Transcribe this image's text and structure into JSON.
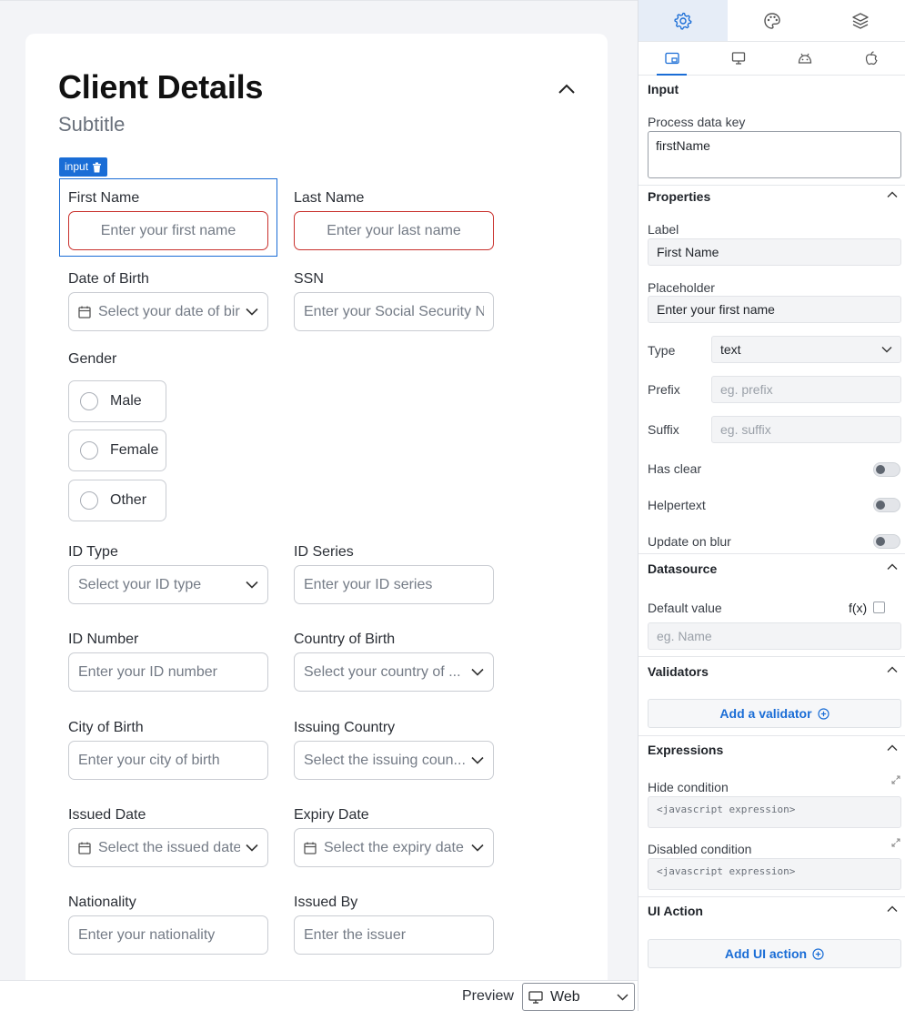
{
  "form": {
    "title": "Client Details",
    "subtitle": "Subtitle",
    "selected_tag": "input",
    "fields": {
      "first_name": {
        "label": "First Name",
        "placeholder": "Enter your first name"
      },
      "last_name": {
        "label": "Last Name",
        "placeholder": "Enter your last name"
      },
      "dob": {
        "label": "Date of Birth",
        "placeholder": "Select your date of birth"
      },
      "ssn": {
        "label": "SSN",
        "placeholder": "Enter your Social Security Number"
      },
      "id_type": {
        "label": "ID Type",
        "placeholder": "Select your ID type"
      },
      "id_series": {
        "label": "ID Series",
        "placeholder": "Enter your ID series"
      },
      "id_number": {
        "label": "ID Number",
        "placeholder": "Enter your ID number"
      },
      "country_of_birth": {
        "label": "Country of Birth",
        "placeholder": "Select your country of ..."
      },
      "city_of_birth": {
        "label": "City of Birth",
        "placeholder": "Enter your city of birth"
      },
      "issuing_country": {
        "label": "Issuing Country",
        "placeholder": "Select the issuing coun..."
      },
      "issued_date": {
        "label": "Issued Date",
        "placeholder": "Select the issued date"
      },
      "expiry_date": {
        "label": "Expiry Date",
        "placeholder": "Select the expiry date"
      },
      "nationality": {
        "label": "Nationality",
        "placeholder": "Enter your nationality"
      },
      "issued_by": {
        "label": "Issued By",
        "placeholder": "Enter the issuer"
      }
    },
    "gender": {
      "label": "Gender",
      "options": [
        "Male",
        "Female",
        "Other"
      ]
    }
  },
  "preview": {
    "label": "Preview",
    "value": "Web"
  },
  "panel": {
    "top_tabs": [
      "settings-icon",
      "palette-icon",
      "layers-icon"
    ],
    "sub_tabs": [
      "web-component-icon",
      "desktop-icon",
      "android-icon",
      "apple-icon"
    ],
    "input_section": {
      "title": "Input",
      "process_key_label": "Process data key",
      "process_key_value": "firstName"
    },
    "properties": {
      "title": "Properties",
      "label_label": "Label",
      "label_value": "First Name",
      "placeholder_label": "Placeholder",
      "placeholder_value": "Enter your first name",
      "type_label": "Type",
      "type_value": "text",
      "prefix_label": "Prefix",
      "prefix_placeholder": "eg. prefix",
      "suffix_label": "Suffix",
      "suffix_placeholder": "eg. suffix",
      "has_clear_label": "Has clear",
      "helpertext_label": "Helpertext",
      "update_on_blur_label": "Update on blur",
      "has_clear": false,
      "helpertext": false,
      "update_on_blur": false
    },
    "datasource": {
      "title": "Datasource",
      "default_value_label": "Default value",
      "fx_label": "f(x)",
      "default_value_placeholder": "eg. Name"
    },
    "validators": {
      "title": "Validators",
      "add_label": "Add a validator"
    },
    "expressions": {
      "title": "Expressions",
      "hide_label": "Hide condition",
      "hide_placeholder": "<javascript expression>",
      "disabled_label": "Disabled condition",
      "disabled_placeholder": "<javascript expression>"
    },
    "ui_action": {
      "title": "UI Action",
      "add_label": "Add UI action"
    }
  },
  "colors": {
    "accent": "#1a6dd6",
    "error": "#c9302c"
  }
}
